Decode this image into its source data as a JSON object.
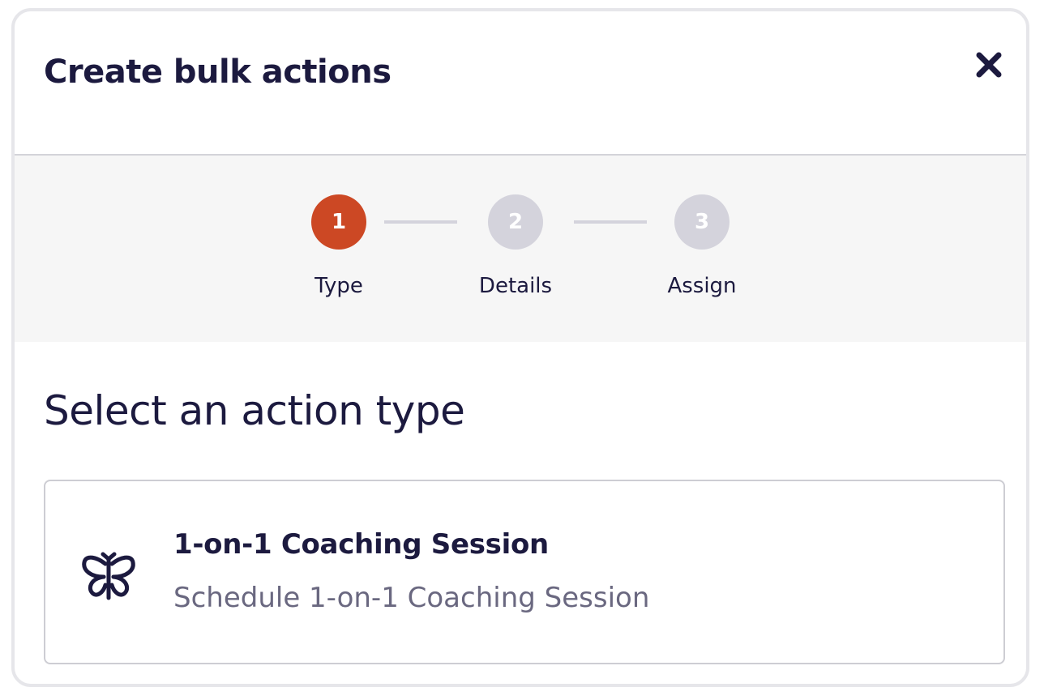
{
  "modal": {
    "title": "Create bulk actions",
    "close_icon": "close-icon"
  },
  "stepper": {
    "steps": [
      {
        "number": "1",
        "label": "Type",
        "state": "active"
      },
      {
        "number": "2",
        "label": "Details",
        "state": "inactive"
      },
      {
        "number": "3",
        "label": "Assign",
        "state": "inactive"
      }
    ],
    "colors": {
      "active": "#cc4824",
      "inactive": "#d4d3dc"
    }
  },
  "main": {
    "heading": "Select an action type",
    "options": [
      {
        "icon": "butterfly-icon",
        "title": "1-on-1 Coaching Session",
        "subtitle": "Schedule 1-on-1 Coaching Session"
      }
    ]
  }
}
